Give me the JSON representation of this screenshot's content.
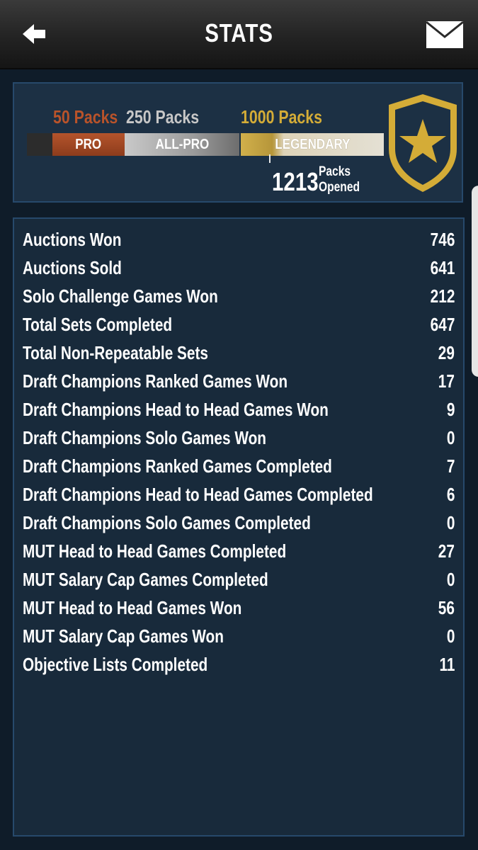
{
  "header": {
    "title": "STATS",
    "back_icon": "back-arrow-icon",
    "mail_icon": "mail-envelope-icon"
  },
  "packs": {
    "tiers": [
      {
        "threshold_label": "50 Packs",
        "bar_label": "PRO",
        "color": "#b4542c"
      },
      {
        "threshold_label": "250 Packs",
        "bar_label": "ALL-PRO",
        "color": "#c9c9c9"
      },
      {
        "threshold_label": "1000 Packs",
        "bar_label": "LEGENDARY",
        "color": "#d1b04b"
      }
    ],
    "opened_count": "1213",
    "opened_caption_line1": "Packs",
    "opened_caption_line2": "Opened",
    "badge_icon": "gold-star-shield-icon",
    "accent_gold": "#d4ac37"
  },
  "stats": [
    {
      "label": "Auctions Won",
      "value": "746"
    },
    {
      "label": "Auctions Sold",
      "value": "641"
    },
    {
      "label": "Solo Challenge Games Won",
      "value": "212"
    },
    {
      "label": "Total Sets Completed",
      "value": "647"
    },
    {
      "label": "Total Non-Repeatable Sets",
      "value": "29"
    },
    {
      "label": "Draft Champions Ranked Games Won",
      "value": "17"
    },
    {
      "label": "Draft Champions Head to Head Games Won",
      "value": "9"
    },
    {
      "label": "Draft Champions Solo Games Won",
      "value": "0"
    },
    {
      "label": "Draft Champions Ranked Games Completed",
      "value": "7"
    },
    {
      "label": "Draft Champions Head to Head Games Completed",
      "value": "6"
    },
    {
      "label": "Draft Champions Solo Games Completed",
      "value": "0"
    },
    {
      "label": "MUT Head to Head Games Completed",
      "value": "27"
    },
    {
      "label": "MUT Salary Cap Games Completed",
      "value": "0"
    },
    {
      "label": "MUT Head to Head Games Won",
      "value": "56"
    },
    {
      "label": "MUT Salary Cap Games Won",
      "value": "0"
    },
    {
      "label": "Objective Lists Completed",
      "value": "11"
    }
  ]
}
